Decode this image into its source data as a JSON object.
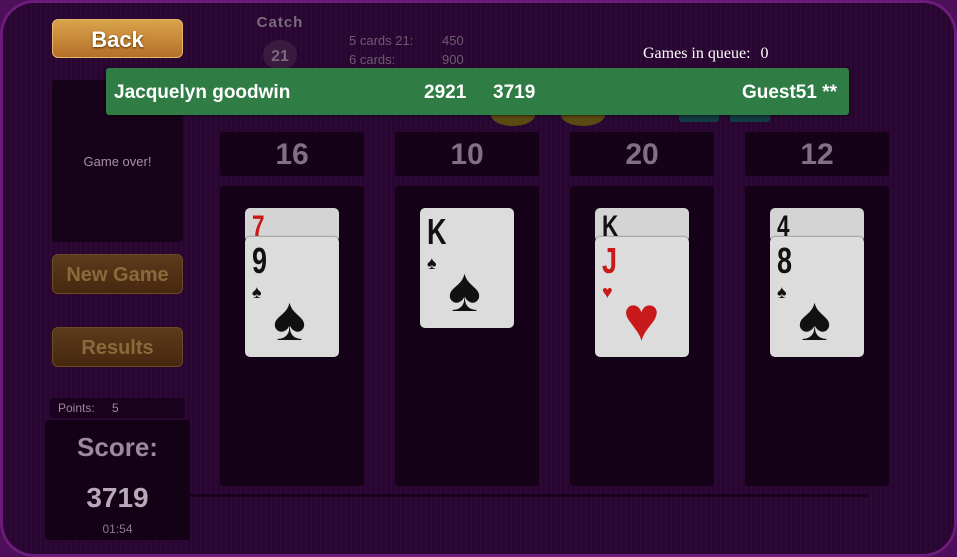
{
  "buttons": {
    "back": "Back",
    "new_game": "New Game",
    "results": "Results"
  },
  "status": "Game over!",
  "points": {
    "label": "Points:",
    "value": "5"
  },
  "score": {
    "label": "Score:",
    "value": "3719",
    "time": "01:54"
  },
  "catch": {
    "label": "Catch",
    "value": "21"
  },
  "bonuses": [
    {
      "label": "5 cards 21:",
      "value": "450"
    },
    {
      "label": "6 cards:",
      "value": "900"
    }
  ],
  "queue": {
    "label": "Games in queue:",
    "value": "0"
  },
  "banner": {
    "player": "Jacquelyn goodwin",
    "score1": "2921",
    "score2": "3719",
    "opponent": "Guest51 **",
    "color": "#2f7c45"
  },
  "columns": [
    {
      "total": "16",
      "cards": [
        {
          "rank": "7",
          "suit": "♦",
          "color": "red"
        },
        {
          "rank": "9",
          "suit": "♠",
          "color": "black"
        }
      ]
    },
    {
      "total": "10",
      "cards": [
        {
          "rank": "K",
          "suit": "♠",
          "color": "black"
        }
      ]
    },
    {
      "total": "20",
      "cards": [
        {
          "rank": "K",
          "suit": "♠",
          "color": "black"
        },
        {
          "rank": "J",
          "suit": "♥",
          "color": "red"
        }
      ]
    },
    {
      "total": "12",
      "cards": [
        {
          "rank": "4",
          "suit": "♠",
          "color": "black"
        },
        {
          "rank": "8",
          "suit": "♠",
          "color": "black"
        }
      ]
    }
  ]
}
